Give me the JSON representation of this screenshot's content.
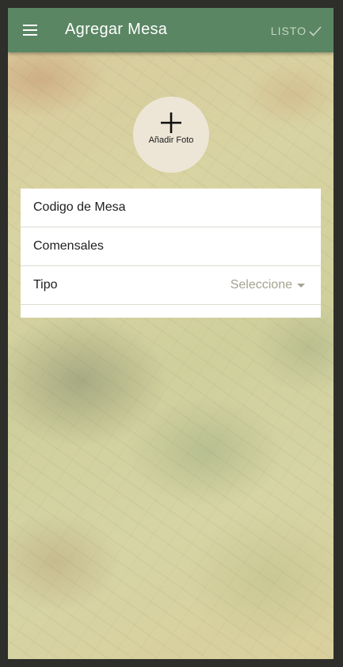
{
  "app_bar": {
    "title": "Agregar Mesa",
    "done_label": "LISTO",
    "menu_icon": "hamburger-menu-icon",
    "done_icon": "check-icon",
    "color": "#5a8663"
  },
  "photo": {
    "label": "Añadir Foto",
    "icon": "plus-icon"
  },
  "form": {
    "fields": [
      {
        "label": "Codigo de Mesa"
      },
      {
        "label": "Comensales"
      },
      {
        "label": "Tipo",
        "select_value": "Seleccione",
        "icon": "caret-down-icon"
      }
    ]
  }
}
